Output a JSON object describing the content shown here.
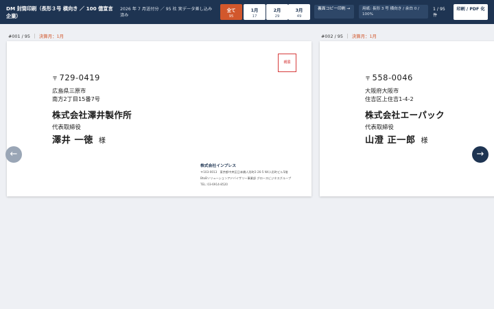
{
  "header": {
    "title": "DM 封筒印刷（長形３号 横向き ／ 100 億宣言企業）",
    "subtitle": "2026 年 7 月送付分 ／ 95 社 実データ差し込み済み",
    "tabs": [
      {
        "label": "全て",
        "count": "95",
        "active": true
      },
      {
        "label": "1月",
        "count": "17",
        "active": false
      },
      {
        "label": "2月",
        "count": "29",
        "active": false
      },
      {
        "label": "3月",
        "count": "49",
        "active": false
      }
    ],
    "reverse_copy_label": "裏面コピー印刷 →",
    "settings_text": "用紙: 長形 3 号 横向き / 余白 0 / 100%",
    "page_counter": "1 / 95 件",
    "print_label": "印刷 / PDF 化"
  },
  "cards": [
    {
      "index": "#001 / 95",
      "month": "決算月：1月",
      "postal_mark": "〒",
      "postal": "729-0419",
      "address_1": "広島県三原市",
      "address_2": "南方2丁目15番7号",
      "company": "株式会社澤井製作所",
      "role": "代表取締役",
      "person": "澤井 一徳",
      "honorific": "様"
    },
    {
      "index": "#002 / 95",
      "month": "決算月：1月",
      "postal_mark": "〒",
      "postal": "558-0046",
      "address_1": "大阪府大阪市",
      "address_2": "住吉区上住吉1-4-2",
      "company": "株式会社エーパック",
      "role": "代表取締役",
      "person": "山澄 正一郎",
      "honorific": "様"
    }
  ],
  "stamp": "親展",
  "sender": {
    "name": "株式会社インプレス",
    "line_1": "〒103-0013　東京都中央区日本橋人形町2-26-5 NX人形町ビル5階",
    "line_2": "BtoBソリューションアドバイザリー事業部 グロースビジネスグループ",
    "line_3": "TEL: 03-6914-8520"
  },
  "nav": {
    "prev": "←",
    "next": "→"
  }
}
